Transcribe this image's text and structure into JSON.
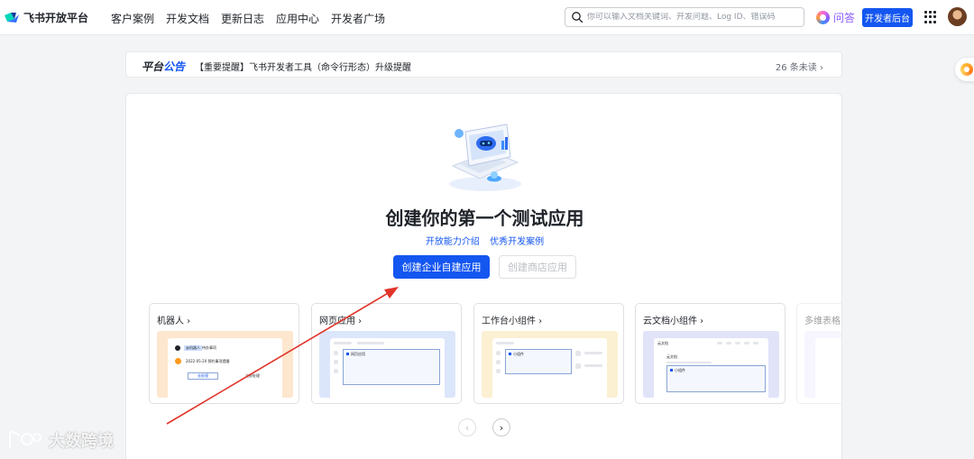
{
  "nav": {
    "logo_text": "飞书开放平台",
    "items": [
      "客户案例",
      "开发文档",
      "更新日志",
      "应用中心",
      "开发者广场"
    ],
    "search_placeholder": "你可以输入文档关键词、开发问题、Log ID、错误码",
    "ask_label": "问答",
    "console_label": "开发者后台"
  },
  "announcement": {
    "tag_part1": "平台",
    "tag_part2": "公告",
    "text": "【重要提醒】飞书开发者工具（命令行形态）升级提醒",
    "unread": "26 条未读 ›"
  },
  "main": {
    "title": "创建你的第一个测试应用",
    "links": [
      "开放能力介绍",
      "优秀开发案例"
    ],
    "primary_button": "创建企业自建应用",
    "secondary_button": "创建商店应用"
  },
  "templates": [
    {
      "title": "机器人 ›",
      "preview_color": "#fde7cf",
      "mini": [
        "@机器人",
        "待办事项",
        "2022-05-20 预约事项提醒",
        "去处理",
        "立即处理"
      ]
    },
    {
      "title": "网页应用 ›",
      "preview_color": "#dce6fb",
      "mini": [
        "网页应用"
      ]
    },
    {
      "title": "工作台小组件 ›",
      "preview_color": "#fbf0d2",
      "mini": [
        "小组件"
      ]
    },
    {
      "title": "云文档小组件 ›",
      "preview_color": "#e1e3f8",
      "mini": [
        "云文档",
        "云文档",
        "小组件"
      ]
    },
    {
      "title": "多维表格",
      "preview_color": "#efe9fb",
      "mini": []
    }
  ],
  "carousel": {
    "prev": "‹",
    "next": "›"
  },
  "watermark": {
    "text": "大数跨境"
  },
  "colors": {
    "brand_blue": "#1456f0",
    "arrow_red": "#e0352b"
  }
}
